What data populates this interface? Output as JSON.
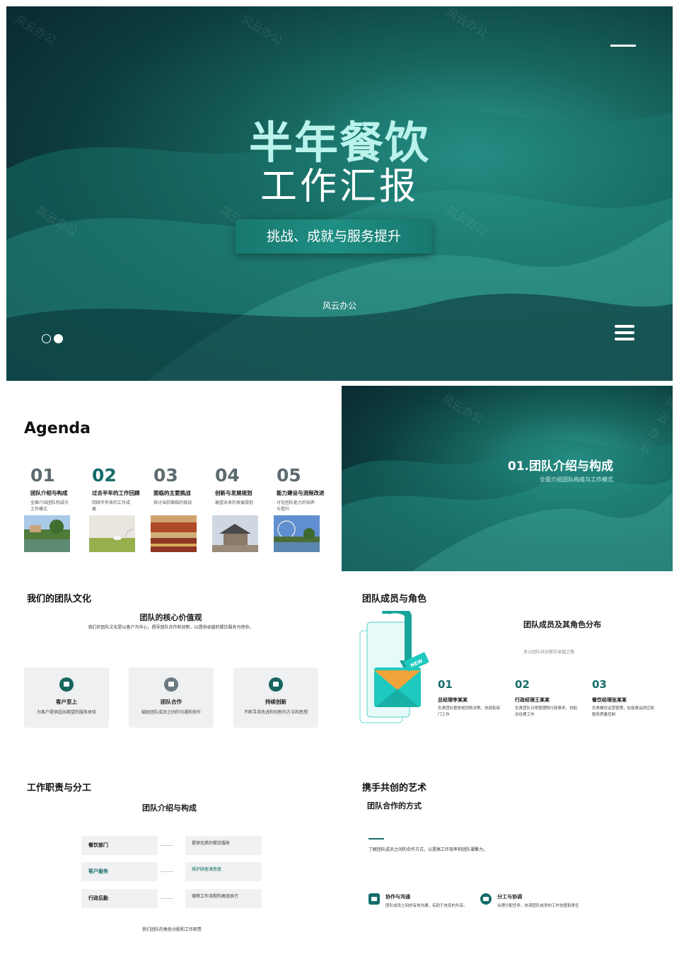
{
  "slide1": {
    "title_line1": "半年餐饮",
    "title_line2": "工作汇报",
    "subtitle": "挑战、成就与服务提升",
    "brand": "风云办公",
    "watermark": "风云办公"
  },
  "agenda": {
    "title": "Agenda",
    "items": [
      {
        "num": "01",
        "head": "团队介绍与构成",
        "desc": "全面介绍团队构成与工作模式"
      },
      {
        "num": "02",
        "head": "过去半年的工作回顾",
        "desc": "回顾半年来的工作成果"
      },
      {
        "num": "03",
        "head": "面临的主要挑战",
        "desc": "探讨当前面临的挑战"
      },
      {
        "num": "04",
        "head": "创新与发展规划",
        "desc": "展望未来的发展规划"
      },
      {
        "num": "05",
        "head": "能力建设与流程改进",
        "desc": "讨论团队能力的培养与提升"
      }
    ]
  },
  "section1": {
    "title": "01.团队介绍与构成",
    "subtitle": "全面介绍团队构成与工作模式"
  },
  "culture": {
    "section_title": "我们的团队文化",
    "heading": "团队的核心价值观",
    "desc": "我们的团队文化是以客户为中心，倡导团队合作和创新，以提供卓越的餐饮服务为使命。",
    "cards": [
      {
        "title": "客户至上",
        "desc": "为客户提供超出期望的服务体验"
      },
      {
        "title": "团队合作",
        "desc": "鼓励团队成员之间的沟通和协作"
      },
      {
        "title": "持续创新",
        "desc": "不断寻求改进和创新的方法和思想"
      }
    ]
  },
  "members": {
    "section_title": "团队成员与角色",
    "heading": "团队成员及其角色分布",
    "desc": "多元团队共创餐饮卓越之路",
    "badge": "NEW",
    "items": [
      {
        "num": "01",
        "name": "总经理李某某",
        "desc": "负责团队整体规划和决策，协调各部门工作"
      },
      {
        "num": "02",
        "name": "行政经理王某某",
        "desc": "负责团队日常管理和行政事务，协助总经理工作"
      },
      {
        "num": "03",
        "name": "餐饮经理张某某",
        "desc": "负责餐饮运营管理，包括食品供应和服务质量控制"
      }
    ]
  },
  "duties": {
    "section_title": "工作职责与分工",
    "heading": "团队介绍与构成",
    "rows": [
      {
        "dept": "餐饮部门",
        "duty": "提供优质的餐饮服务"
      },
      {
        "dept": "客户服务",
        "duty": "维护顾客满意度"
      },
      {
        "dept": "行政后勤",
        "duty": "保障工作流程的高效执行"
      }
    ],
    "footer": "我们团队的角色分配和工作职责"
  },
  "collab": {
    "section_title": "携手共创的艺术",
    "heading": "团队合作的方式",
    "desc": "了解团队成员之间的合作方式，以提高工作效率和团队凝聚力。",
    "items": [
      {
        "title": "协作与沟通",
        "desc": "团队成员之间的有效沟通，有助于信息的共享。"
      },
      {
        "title": "分工与协调",
        "desc": "合理分配任务，协调团队成员的工作进度和责任"
      }
    ]
  },
  "colors": {
    "accent": "#146d6a",
    "title_cyan": "#b9f3ec",
    "dark": "#0d3d3f"
  }
}
